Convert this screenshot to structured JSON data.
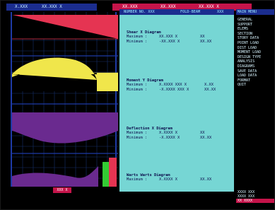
{
  "topbar": {
    "cell_1": "X.XXX",
    "cell_2": "XX.XXX X",
    "cell_3": "XX.XXX",
    "cell_4": "XX.XXX",
    "cell_5": "XX.XXX X"
  },
  "panel": {
    "header_left": "NUMBER NO. XXX",
    "header_mid": "FOLD-BEAM",
    "header_right": "XXX",
    "sections": [
      {
        "title": "Shear X Diagram",
        "rows": [
          {
            "label": "Maximum :",
            "value": "XX.XXX X",
            "unit": "XX"
          },
          {
            "label": "Minimum :",
            "value": "-XX.XXX X",
            "unit": "XX.XX"
          }
        ]
      },
      {
        "title": "Moment Y Diagram",
        "rows": [
          {
            "label": "Maximum :",
            "value": "X.XXXX XXX X",
            "unit": "X.XX"
          },
          {
            "label": "Minimum :",
            "value": "-X.XXXX XXX X",
            "unit": "XX.XX"
          }
        ]
      },
      {
        "title": "Deflection X Diagram",
        "rows": [
          {
            "label": "Maximum :",
            "value": "X.XXXX X",
            "unit": "XX"
          },
          {
            "label": "Minimum :",
            "value": "-X.XXXX X",
            "unit": "XX.XX"
          }
        ]
      },
      {
        "title": "Warts Warts Diagram",
        "rows": [
          {
            "label": "Maximum :",
            "value": "X.XXXX X",
            "unit": "XX.XX"
          }
        ]
      }
    ]
  },
  "menu": {
    "title": "MAIN MENU",
    "items": [
      "GENERAL",
      "SUPPORT",
      "ELEMS",
      "SECTION",
      "STORY DATA",
      "POINT LOAD",
      "DIST LOAD",
      "MOMENT LOAD",
      "DESIGN TYPE",
      "ANALYSIS",
      "DIAGRAMS",
      "SAVE DATA",
      "LOAD DATA",
      "FORMAT",
      "QUIT"
    ]
  },
  "menu_lower": {
    "items": [
      "XXXX XXX",
      "XXXX XXX",
      "XX XXXX"
    ],
    "highlight_index": 2
  },
  "bottombar": {
    "tag": "XXX X"
  },
  "colors": {
    "background": "#000000",
    "panel": "#76d6d4",
    "header": "#1b2d8f",
    "accent_red": "#c5144a",
    "shear": "#e53452",
    "moment": "#f0e64b",
    "deflection": "#6a2a8f",
    "warts_green": "#33cc33"
  }
}
